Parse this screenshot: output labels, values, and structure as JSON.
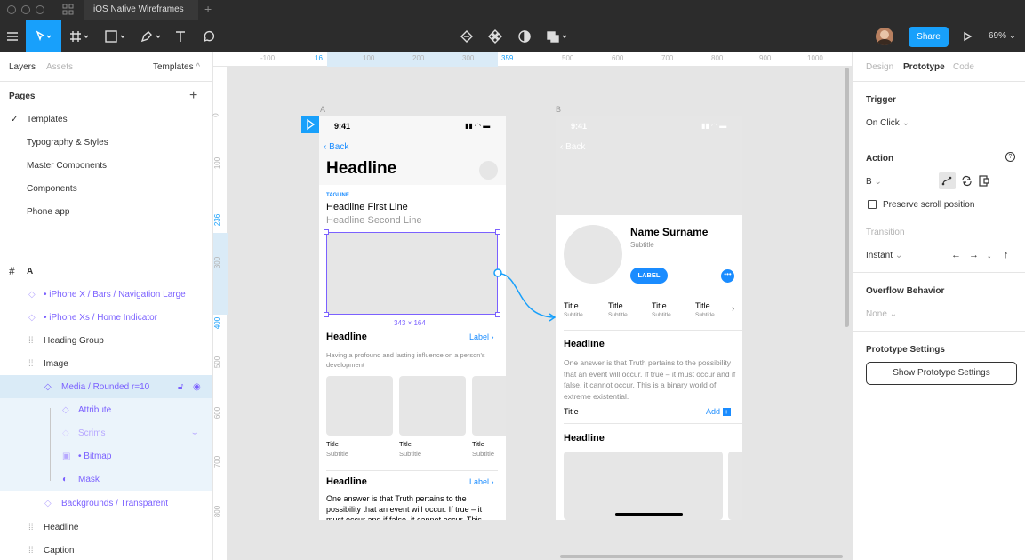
{
  "window": {
    "tab_title": "iOS Native Wireframes",
    "new_tab": "+"
  },
  "toolbar": {
    "share_label": "Share",
    "zoom": "69%"
  },
  "left_panel": {
    "tabs": [
      "Layers",
      "Assets"
    ],
    "templates_label": "Templates",
    "pages_label": "Pages",
    "add_page": "+",
    "pages": [
      "Templates",
      "Typography & Styles",
      "Master Components",
      "Components",
      "Phone app"
    ],
    "frame_label": "A",
    "layers": [
      "• iPhone X / Bars / Navigation Large",
      "• iPhone Xs / Home Indicator",
      "Heading Group",
      "Image",
      "Media / Rounded r=10",
      "Attribute",
      "Scrims",
      "• Bitmap",
      "Mask",
      "Backgrounds / Transparent",
      "Headline",
      "Caption"
    ]
  },
  "rulers": {
    "h": [
      "-100",
      "16",
      "100",
      "200",
      "300",
      "359",
      "500",
      "600",
      "700",
      "800",
      "900",
      "1000"
    ],
    "v": [
      "0",
      "100",
      "236",
      "300",
      "400",
      "500",
      "600",
      "700",
      "800"
    ]
  },
  "canvas": {
    "frame_a_label": "A",
    "frame_b_label": "B",
    "size_label": "343 × 164",
    "frame_a": {
      "time": "9:41",
      "back": "Back",
      "headline": "Headline",
      "tagline": "TAGLINE",
      "first_line": "Headline First Line",
      "second_line": "Headline Second Line",
      "section_headline": "Headline",
      "label": "Label",
      "body": "Having a profound and lasting influence on a person's development",
      "cards": [
        {
          "title": "Title",
          "subtitle": "Subtitle"
        },
        {
          "title": "Title",
          "subtitle": "Subtitle"
        },
        {
          "title": "Title",
          "subtitle": "Subtitle"
        }
      ],
      "section2_headline": "Headline",
      "section2_label": "Label",
      "section2_body": "One answer is that Truth pertains to the possibility that an event will occur. If true – it must occur and if false, it cannot occur. This"
    },
    "frame_b": {
      "time": "9:41",
      "back": "Back",
      "name": "Name Surname",
      "subtitle": "Subtitle",
      "label_btn": "LABEL",
      "stats": [
        {
          "title": "Title",
          "subtitle": "Subtitle"
        },
        {
          "title": "Title",
          "subtitle": "Subtitle"
        },
        {
          "title": "Title",
          "subtitle": "Subtitle"
        },
        {
          "title": "Title",
          "subtitle": "Subtitle"
        }
      ],
      "headline": "Headline",
      "body": "One answer is that Truth pertains to the possibility that an event will occur. If true – it must occur and if false, it cannot occur. This is a binary world of extreme existential.",
      "row_title": "Title",
      "add": "Add",
      "headline2": "Headline"
    }
  },
  "right_panel": {
    "tabs": [
      "Design",
      "Prototype",
      "Code"
    ],
    "trigger_label": "Trigger",
    "trigger_value": "On Click",
    "action_label": "Action",
    "action_dest": "B",
    "preserve_scroll": "Preserve scroll position",
    "transition_label": "Transition",
    "transition_value": "Instant",
    "overflow_label": "Overflow Behavior",
    "overflow_value": "None",
    "proto_settings_label": "Prototype Settings",
    "proto_settings_button": "Show Prototype Settings"
  },
  "colors": {
    "accent": "#18a0fb",
    "purple": "#7b61ff",
    "ios_blue": "#1a8cff"
  }
}
